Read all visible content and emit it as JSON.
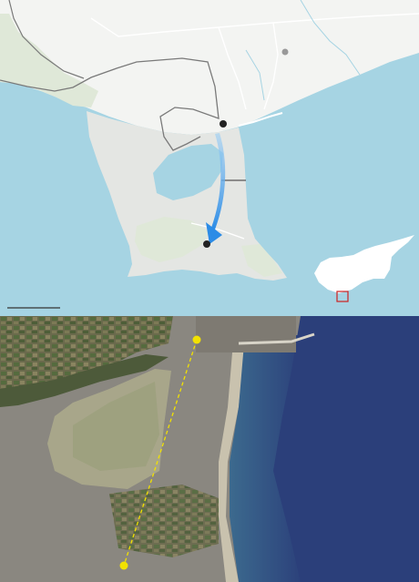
{
  "map": {
    "water_color": "#a6d4e3",
    "land_color": "#f3f4f2",
    "peninsula_color": "#e4e6e3",
    "vegetation_color": "#dfe8d8",
    "lake_color": "#a6d4e3",
    "border_color": "#7a7a7a",
    "route_arrow_color": "#2c8ce6",
    "marker_color": "#222222",
    "city_marker_color": "#999999",
    "inset_box_color": "#cc2222",
    "scale_bar": ""
  },
  "satellite": {
    "route_line_color": "#f2e200",
    "marker_color": "#f2e200",
    "sea_color": "#2b3f7a"
  }
}
